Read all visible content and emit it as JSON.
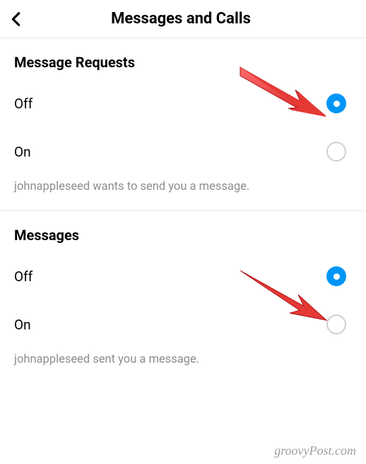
{
  "header": {
    "title": "Messages and Calls"
  },
  "sections": [
    {
      "title": "Message Requests",
      "options": [
        {
          "label": "Off",
          "selected": true
        },
        {
          "label": "On",
          "selected": false
        }
      ],
      "helper": "johnappleseed wants to send you a message."
    },
    {
      "title": "Messages",
      "options": [
        {
          "label": "Off",
          "selected": true
        },
        {
          "label": "On",
          "selected": false
        }
      ],
      "helper": "johnappleseed sent you a message."
    }
  ],
  "watermark": "groovyPost.com"
}
